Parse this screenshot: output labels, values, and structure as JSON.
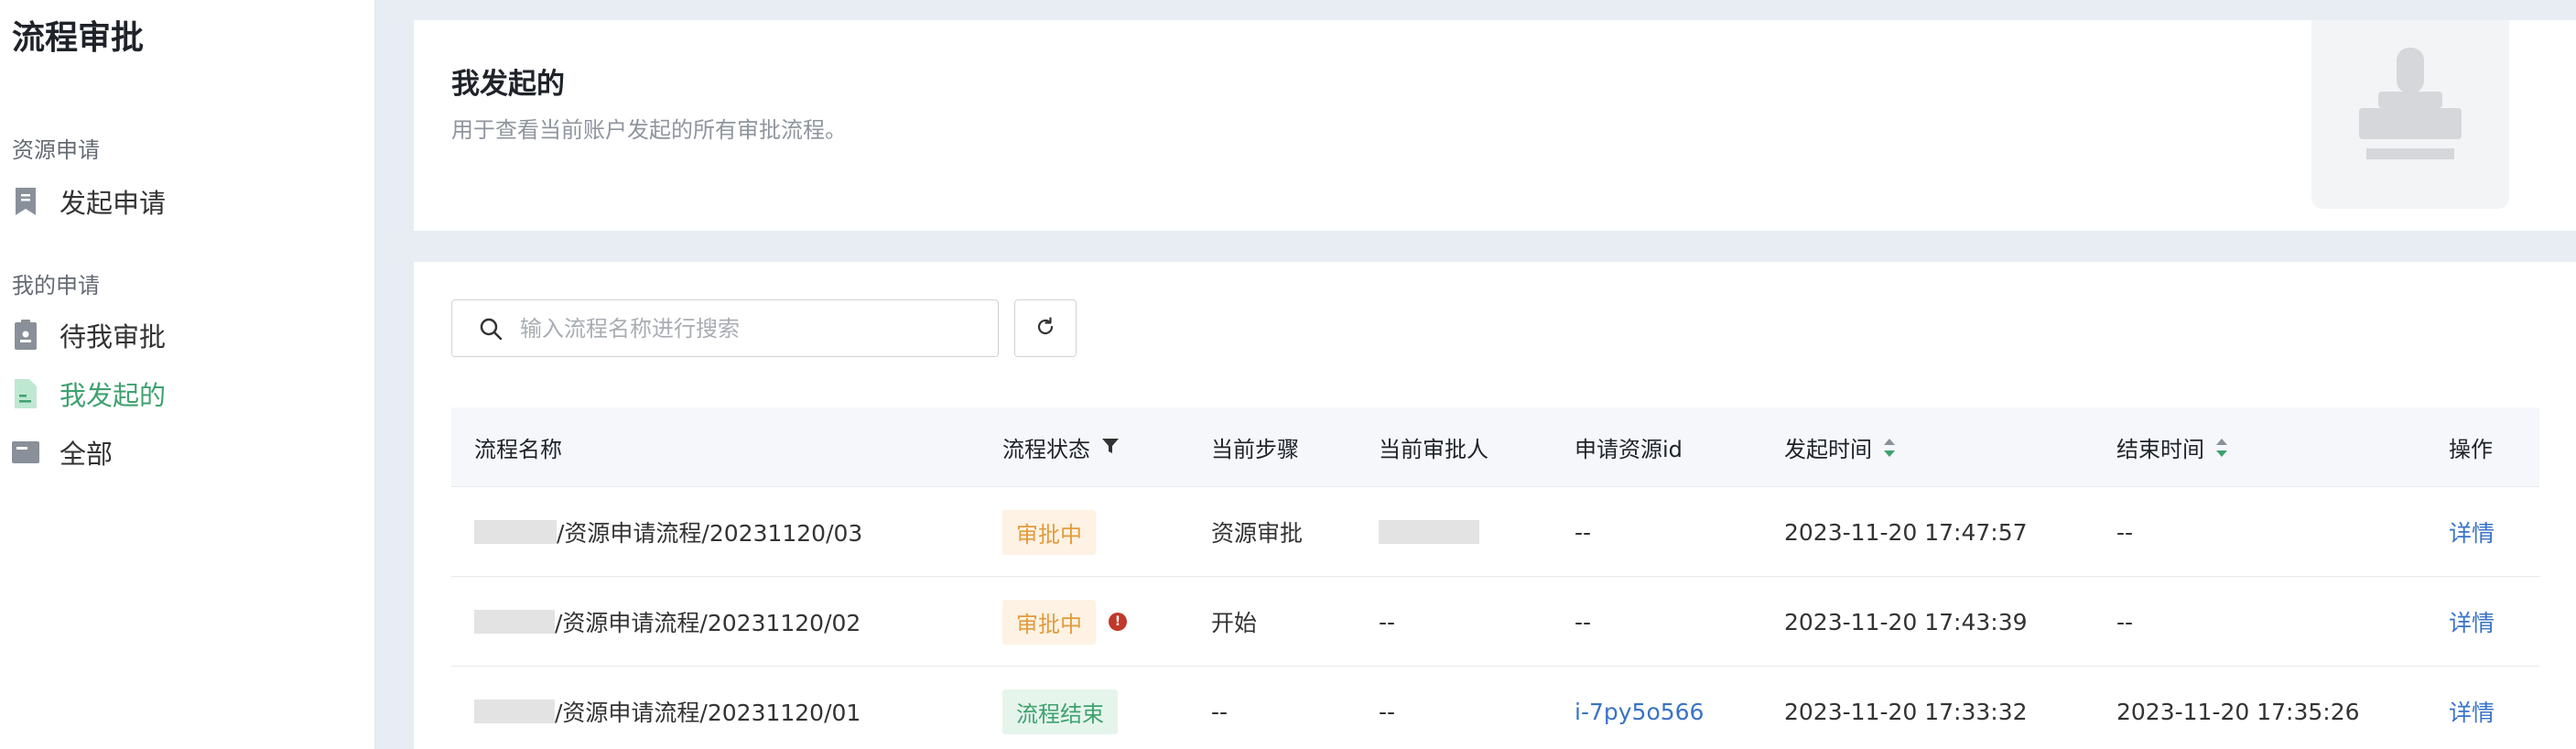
{
  "sidebar": {
    "title": "流程审批",
    "groups": [
      {
        "title": "资源申请",
        "items": [
          {
            "label": "发起申请",
            "icon": "bookmark-icon",
            "active": false
          }
        ]
      },
      {
        "title": "我的申请",
        "items": [
          {
            "label": "待我审批",
            "icon": "stamp-icon",
            "active": false
          },
          {
            "label": "我发起的",
            "icon": "document-icon",
            "active": true
          },
          {
            "label": "全部",
            "icon": "folder-icon",
            "active": false
          }
        ]
      }
    ]
  },
  "header": {
    "title": "我发起的",
    "description": "用于查看当前账户发起的所有审批流程。"
  },
  "search": {
    "placeholder": "输入流程名称进行搜索",
    "value": ""
  },
  "table": {
    "columns": [
      "流程名称",
      "流程状态",
      "当前步骤",
      "当前审批人",
      "申请资源id",
      "发起时间",
      "结束时间",
      "操作"
    ],
    "rows": [
      {
        "name": "/资源申请流程/20231120/03",
        "status": "审批中",
        "status_type": "pending",
        "warning": false,
        "step": "资源审批",
        "approver": "",
        "resource_id": "--",
        "start_time": "2023-11-20 17:47:57",
        "end_time": "--",
        "action": "详情"
      },
      {
        "name": "/资源申请流程/20231120/02",
        "status": "审批中",
        "status_type": "pending",
        "warning": true,
        "step": "开始",
        "approver": "--",
        "resource_id": "--",
        "start_time": "2023-11-20 17:43:39",
        "end_time": "--",
        "action": "详情"
      },
      {
        "name": "/资源申请流程/20231120/01",
        "status": "流程结束",
        "status_type": "done",
        "warning": false,
        "step": "--",
        "approver": "--",
        "resource_id": "i-7py5o566",
        "start_time": "2023-11-20 17:33:32",
        "end_time": "2023-11-20 17:35:26",
        "action": "详情"
      }
    ]
  },
  "colors": {
    "accent": "#3fa16f",
    "link": "#3a73c6",
    "pending": "#e39b3c",
    "warning": "#c0392b"
  }
}
